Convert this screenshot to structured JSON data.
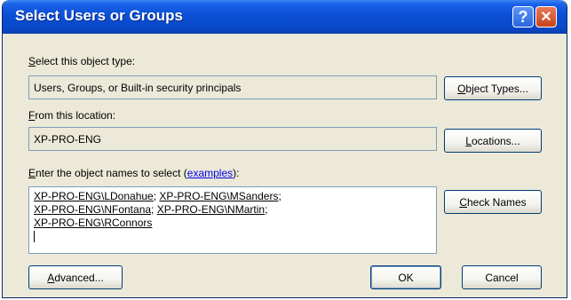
{
  "window": {
    "title": "Select Users or Groups"
  },
  "titlebar_buttons": {
    "help": "?",
    "close": "✕"
  },
  "object_type": {
    "label_key": "S",
    "label_rest": "elect this object type:",
    "value": "Users, Groups, or Built-in security principals",
    "button_key": "O",
    "button_rest": "bject Types..."
  },
  "location": {
    "label_key": "F",
    "label_rest": "rom this location:",
    "value": "XP-PRO-ENG",
    "button_key": "L",
    "button_rest": "ocations..."
  },
  "names": {
    "label_key": "E",
    "label_rest": "nter the object names to select (",
    "examples_link": "examples",
    "label_end": "):",
    "entries": [
      "XP-PRO-ENG\\LDonahue",
      "XP-PRO-ENG\\MSanders",
      "XP-PRO-ENG\\NFontana",
      "XP-PRO-ENG\\NMartin",
      "XP-PRO-ENG\\RConnors"
    ],
    "separator": "; ",
    "check_key": "C",
    "check_rest": "heck Names"
  },
  "footer": {
    "advanced_key": "A",
    "advanced_rest": "dvanced...",
    "ok": "OK",
    "cancel": "Cancel"
  }
}
